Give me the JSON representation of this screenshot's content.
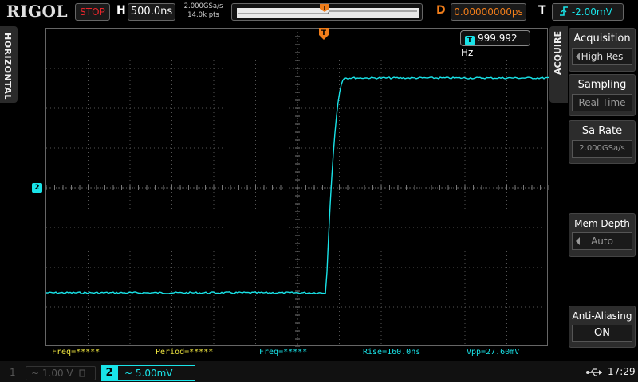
{
  "header": {
    "brand": "RIGOL",
    "run_status": "STOP",
    "horizontal_label": "H",
    "timebase": "500.0ns",
    "sample_rate": "2.000GSa/s",
    "memory_points": "14.0k pts",
    "delay_label": "D",
    "delay_value": "0.00000000ps",
    "trigger_label": "T",
    "trigger_level": "-2.00mV"
  },
  "left_tab": {
    "label": "HORIZONTAL"
  },
  "display": {
    "frequency_counter": "999.992 Hz",
    "trigger_marker_text": "T",
    "channel_marker": "2",
    "trace_color": "#19e3e8",
    "waveform": {
      "low_level_fraction": 0.83,
      "high_level_fraction": 0.155,
      "edge_start_fraction": 0.557,
      "edge_end_fraction": 0.595
    }
  },
  "measurements": [
    {
      "text": "Freq=*****",
      "color": "#f0e640"
    },
    {
      "text": "Period=*****",
      "color": "#f0e640"
    },
    {
      "text": "Freq=*****",
      "color": "#19e3e8"
    },
    {
      "text": "Rise=160.0ns",
      "color": "#19e3e8"
    },
    {
      "text": "Vpp=27.60mV",
      "color": "#19e3e8"
    }
  ],
  "footer": {
    "ch1_number": "1",
    "ch1_scale": "~ 1.00 V",
    "ch2_number": "2",
    "ch2_scale": "~  5.00mV",
    "time": "17:29"
  },
  "menu": {
    "tab_label": "ACQUIRE",
    "items": [
      {
        "title": "Acquisition",
        "value": "High Res"
      },
      {
        "title": "Sampling",
        "value": "Real Time"
      },
      {
        "title": "Sa Rate",
        "value": "2.000GSa/s"
      },
      {
        "title": "Mem Depth",
        "value": "Auto"
      },
      {
        "title": "Anti-Aliasing",
        "value": "ON"
      }
    ]
  }
}
